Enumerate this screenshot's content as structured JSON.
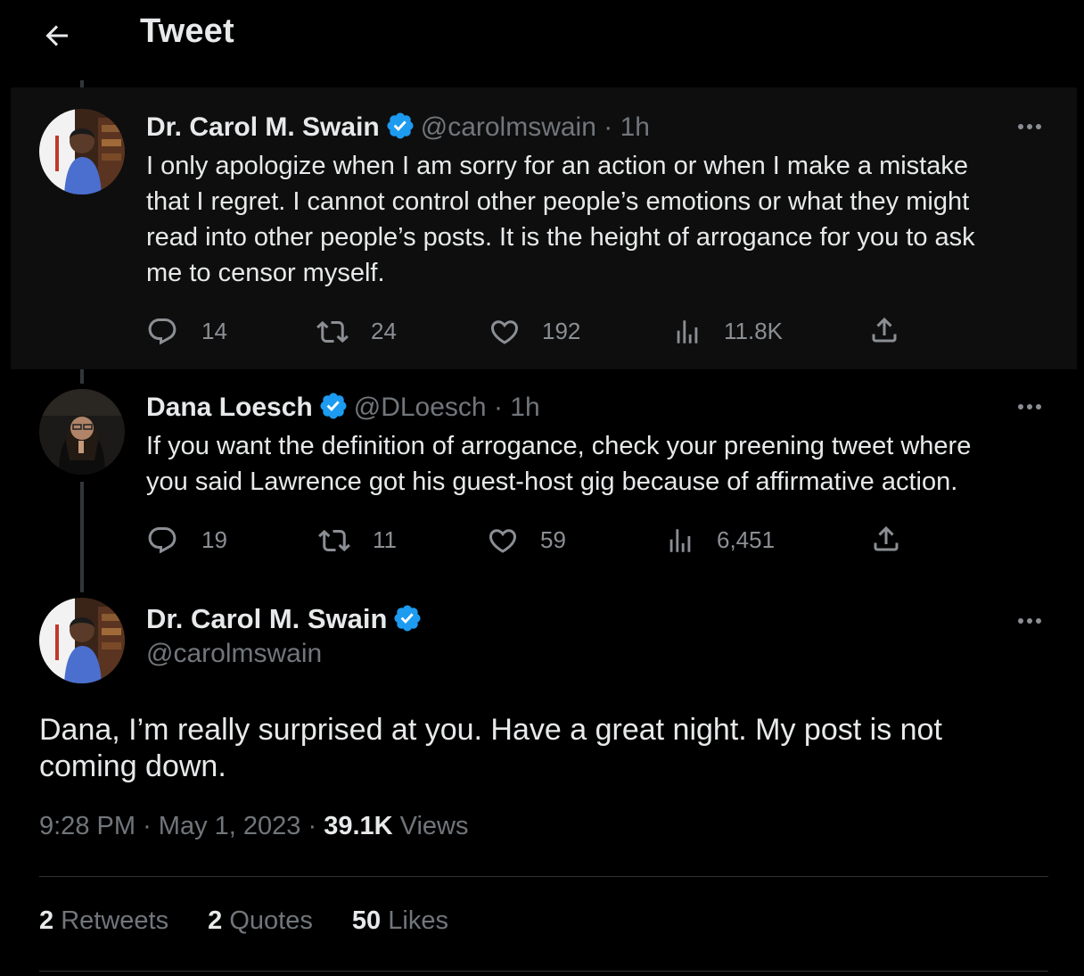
{
  "header": {
    "title": "Tweet"
  },
  "replies": [
    {
      "name": "Dr. Carol M. Swain",
      "handle": "@carolmswain",
      "separator": "·",
      "time": "1h",
      "lines": [
        "I only apologize when I am sorry for an action or when I make a mistake",
        "that I regret. I cannot control other people’s emotions or what they might",
        "read into other people’s posts. It is the height of arrogance for you to ask",
        "me to censor myself."
      ],
      "stats": {
        "replies": "14",
        "retweets": "24",
        "likes": "192",
        "views": "11.8K"
      }
    },
    {
      "name": "Dana Loesch",
      "handle": "@DLoesch",
      "separator": "·",
      "time": "1h",
      "lines": [
        "If you want the definition of arrogance, check your preening tweet where",
        "you said Lawrence got his guest-host gig because of affirmative action."
      ],
      "stats": {
        "replies": "19",
        "retweets": "11",
        "likes": "59",
        "views": "6,451"
      }
    }
  ],
  "main": {
    "name": "Dr. Carol M. Swain",
    "handle": "@carolmswain",
    "lines": [
      "Dana, I’m really surprised at you. Have a great night. My post is not",
      "coming down."
    ],
    "time": "9:28 PM",
    "date": "May 1, 2023",
    "separator": "·",
    "views_count": "39.1K",
    "views_label": "Views",
    "retweets_count": "2",
    "retweets_label": "Retweets",
    "quotes_count": "2",
    "quotes_label": "Quotes",
    "likes_count": "50",
    "likes_label": "Likes"
  },
  "colors": {
    "background": "#000000",
    "text": "#e7e9ea",
    "secondary": "#71767b",
    "verified": "#1d9bf0",
    "thread_line": "#333639"
  },
  "icons": [
    "back-arrow-icon",
    "verified-badge-icon",
    "more-icon",
    "reply-icon",
    "retweet-icon",
    "like-icon",
    "views-icon",
    "share-icon"
  ]
}
